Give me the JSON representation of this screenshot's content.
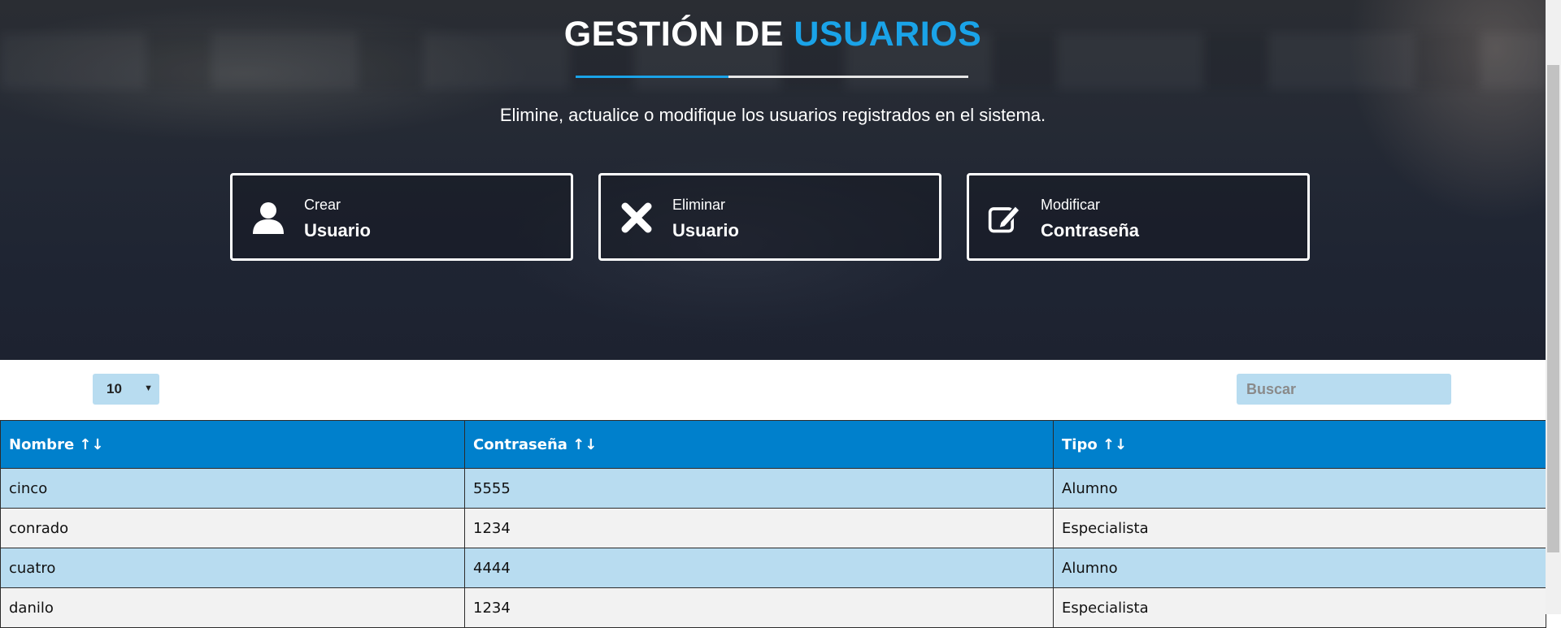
{
  "header": {
    "title_part1": "GESTIÓN DE",
    "title_part2": "USUARIOS",
    "subtitle": "Elimine, actualice o modifique los usuarios registrados en el sistema."
  },
  "actions": [
    {
      "small": "Crear",
      "big": "Usuario",
      "icon": "user-icon"
    },
    {
      "small": "Eliminar",
      "big": "Usuario",
      "icon": "close-icon"
    },
    {
      "small": "Modificar",
      "big": "Contraseña",
      "icon": "edit-icon"
    }
  ],
  "controls": {
    "page_length": "10",
    "search_placeholder": "Buscar"
  },
  "table": {
    "columns": [
      "Nombre ↑↓",
      "Contraseña ↑↓",
      "Tipo ↑↓"
    ],
    "rows": [
      [
        "cinco",
        "5555",
        "Alumno"
      ],
      [
        "conrado",
        "1234",
        "Especialista"
      ],
      [
        "cuatro",
        "4444",
        "Alumno"
      ],
      [
        "danilo",
        "1234",
        "Especialista"
      ]
    ]
  },
  "colors": {
    "accent": "#1aa3e8",
    "table_header": "#0080cc",
    "row_highlight": "#b8dcf0",
    "row_alt": "#f2f2f2"
  }
}
